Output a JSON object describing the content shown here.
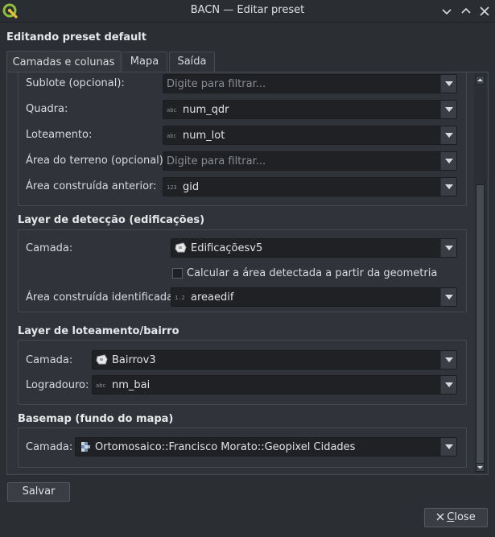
{
  "window": {
    "title": "BACN — Editar preset",
    "app_icon": "qgis-logo-icon",
    "controls": [
      "chevron-down-icon",
      "chevron-up-icon",
      "close-icon"
    ]
  },
  "heading": "Editando preset default",
  "tabs": [
    {
      "label": "Camadas e colunas",
      "active": true
    },
    {
      "label": "Mapa",
      "active": false
    },
    {
      "label": "Saída",
      "active": false
    }
  ],
  "lot_section": {
    "fields": [
      {
        "label": "Sublote (opcional):",
        "value": "",
        "placeholder": "Digite para filtrar...",
        "icon": ""
      },
      {
        "label": "Quadra:",
        "value": "num_qdr",
        "placeholder": "",
        "icon": "abc"
      },
      {
        "label": "Loteamento:",
        "value": "num_lot",
        "placeholder": "",
        "icon": "abc"
      },
      {
        "label": "Área do terreno (opcional):",
        "value": "",
        "placeholder": "Digite para filtrar...",
        "icon": ""
      },
      {
        "label": "Área construída anterior:",
        "value": "gid",
        "placeholder": "",
        "icon": "123"
      }
    ]
  },
  "detection": {
    "title": "Layer de detecção (edificações)",
    "layer_label": "Camada:",
    "layer_value": "Edificaçõesv5",
    "layer_icon": "polygon-layer-icon",
    "checkbox_label": "Calcular a área detectada a partir da geometria",
    "checkbox_checked": false,
    "area_label": "Área construída identificada:",
    "area_value": "areaedif",
    "area_icon": "1.2"
  },
  "lotbairro": {
    "title": "Layer de loteamento/bairro",
    "layer_label": "Camada:",
    "layer_value": "Bairrov3",
    "layer_icon": "polygon-layer-icon",
    "street_label": "Logradouro:",
    "street_value": "nm_bai",
    "street_icon": "abc"
  },
  "basemap": {
    "title": "Basemap (fundo do mapa)",
    "layer_label": "Camada:",
    "layer_value": "Ortomosaico::Francisco Morato::Geopixel Cidades",
    "layer_icon": "raster-layer-icon"
  },
  "buttons": {
    "save": "Salvar",
    "close": "Close"
  },
  "colors": {
    "background": "#2b2e33",
    "panel": "#30343a",
    "input": "#1f2125",
    "border": "#474b51",
    "qgis_green": "#8fbf3f"
  }
}
